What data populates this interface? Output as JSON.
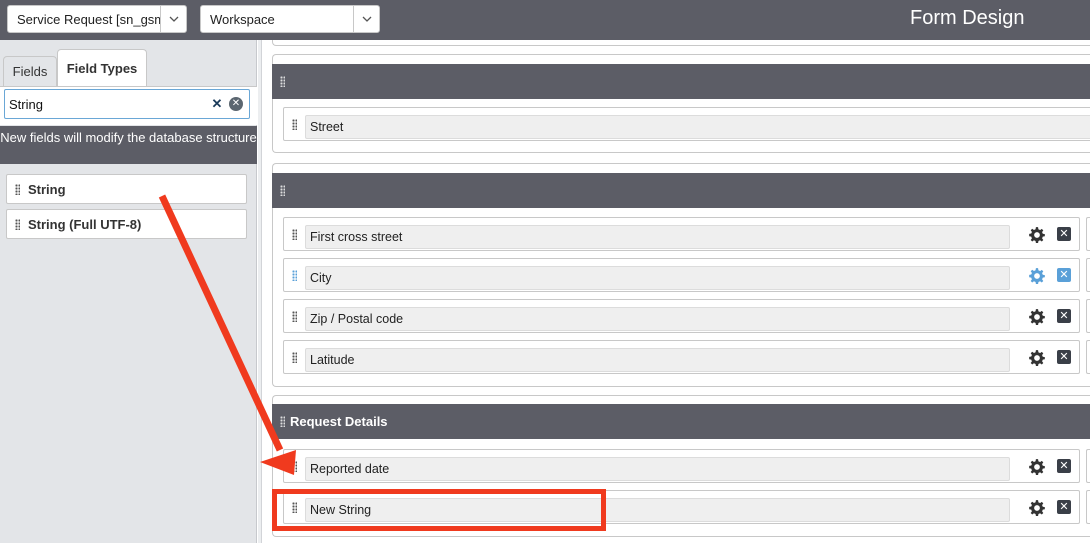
{
  "topbar": {
    "table_select": "Service Request [sn_gsm_",
    "view_select": "Workspace",
    "title": "Form Design"
  },
  "left_panel": {
    "tabs": [
      {
        "label": "Fields"
      },
      {
        "label": "Field Types"
      }
    ],
    "search": {
      "value": "String"
    },
    "notice": "New fields will modify the database structure",
    "field_types": [
      {
        "label": "String"
      },
      {
        "label": "String (Full UTF-8)"
      }
    ]
  },
  "form": {
    "sections": [
      {
        "title": "",
        "fields": [
          {
            "label": "Street"
          }
        ]
      },
      {
        "title": "",
        "fields": [
          {
            "label": "First cross street"
          },
          {
            "label": "City"
          },
          {
            "label": "Zip / Postal code"
          },
          {
            "label": "Latitude"
          }
        ]
      },
      {
        "title": "Request Details",
        "fields": [
          {
            "label": "Reported date"
          },
          {
            "label": "New String"
          }
        ]
      }
    ]
  },
  "annotation": {
    "color": "#f03a1e"
  }
}
